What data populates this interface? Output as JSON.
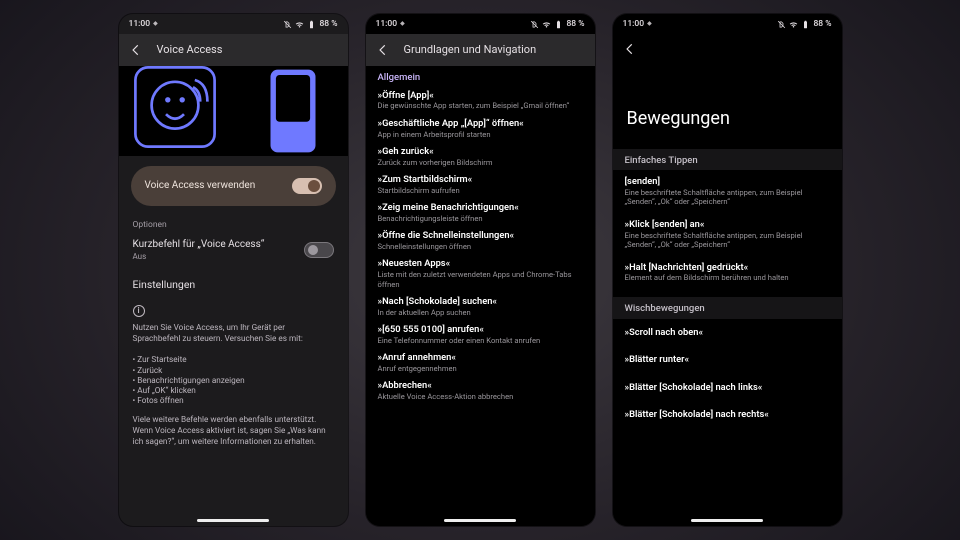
{
  "statusbar": {
    "time": "11:00",
    "battery": "88 %",
    "diamond": "◆",
    "bell_muted": true
  },
  "screen1": {
    "title": "Voice Access",
    "use_toggle_label": "Voice Access verwenden",
    "use_toggle_on": true,
    "options_label": "Optionen",
    "shortcut_title": "Kurzbefehl für „Voice Access“",
    "shortcut_sub": "Aus",
    "shortcut_on": false,
    "settings_label": "Einstellungen",
    "info_paragraph": "Nutzen Sie Voice Access, um Ihr Gerät per Sprachbefehl zu steuern. Versuchen Sie es mit:",
    "bullets": [
      "Zur Startseite",
      "Zurück",
      "Benachrichtigungen anzeigen",
      "Auf „OK“ klicken",
      "Fotos öffnen"
    ],
    "footer": "Viele weitere Befehle werden ebenfalls unterstützt. Wenn Voice Access aktiviert ist, sagen Sie „Was kann ich sagen?“, um weitere Informationen zu erhalten."
  },
  "screen2": {
    "title": "Grundlagen und Navigation",
    "category": "Allgemein",
    "items": [
      {
        "c": "»Öffne [App]«",
        "d": "Die gewünschte App starten, zum Beispiel „Gmail öffnen“"
      },
      {
        "c": "»Geschäftliche App „[App]“ öffnen«",
        "d": "App in einem Arbeitsprofil starten"
      },
      {
        "c": "»Geh zurück«",
        "d": "Zurück zum vorherigen Bildschirm"
      },
      {
        "c": "»Zum Startbildschirm«",
        "d": "Startbildschirm aufrufen"
      },
      {
        "c": "»Zeig meine Benachrichtigungen«",
        "d": "Benachrichtigungsleiste öffnen"
      },
      {
        "c": "»Öffne die Schnelleinstellungen«",
        "d": "Schnelleinstellungen öffnen"
      },
      {
        "c": "»Neuesten Apps«",
        "d": "Liste mit den zuletzt verwendeten Apps und Chrome-Tabs öffnen"
      },
      {
        "c": "»Nach [Schokolade] suchen«",
        "d": "In der aktuellen App suchen"
      },
      {
        "c": "»[650 555 0100] anrufen«",
        "d": "Eine Telefonnummer oder einen Kontakt anrufen"
      },
      {
        "c": "»Anruf annehmen«",
        "d": "Anruf entgegennehmen"
      },
      {
        "c": "»Abbrechen«",
        "d": "Aktuelle Voice Access-Aktion abbrechen"
      }
    ]
  },
  "screen3": {
    "big_title": "Bewegungen",
    "section1_head": "Einfaches Tippen",
    "section1": [
      {
        "c": "[senden]",
        "d": "Eine beschriftete Schaltfläche antippen, zum Beispiel „Senden“, „Ok“ oder „Speichern“"
      },
      {
        "c": "»Klick [senden] an«",
        "d": "Eine beschriftete Schaltfläche antippen, zum Beispiel „Senden“, „Ok“ oder „Speichern“"
      },
      {
        "c": "»Halt [Nachrichten] gedrückt«",
        "d": "Element auf dem Bildschirm berühren und halten"
      }
    ],
    "section2_head": "Wischbewegungen",
    "section2": [
      "»Scroll nach oben«",
      "»Blätter runter«",
      "»Blätter [Schokolade] nach links«",
      "»Blätter [Schokolade] nach rechts«"
    ]
  }
}
